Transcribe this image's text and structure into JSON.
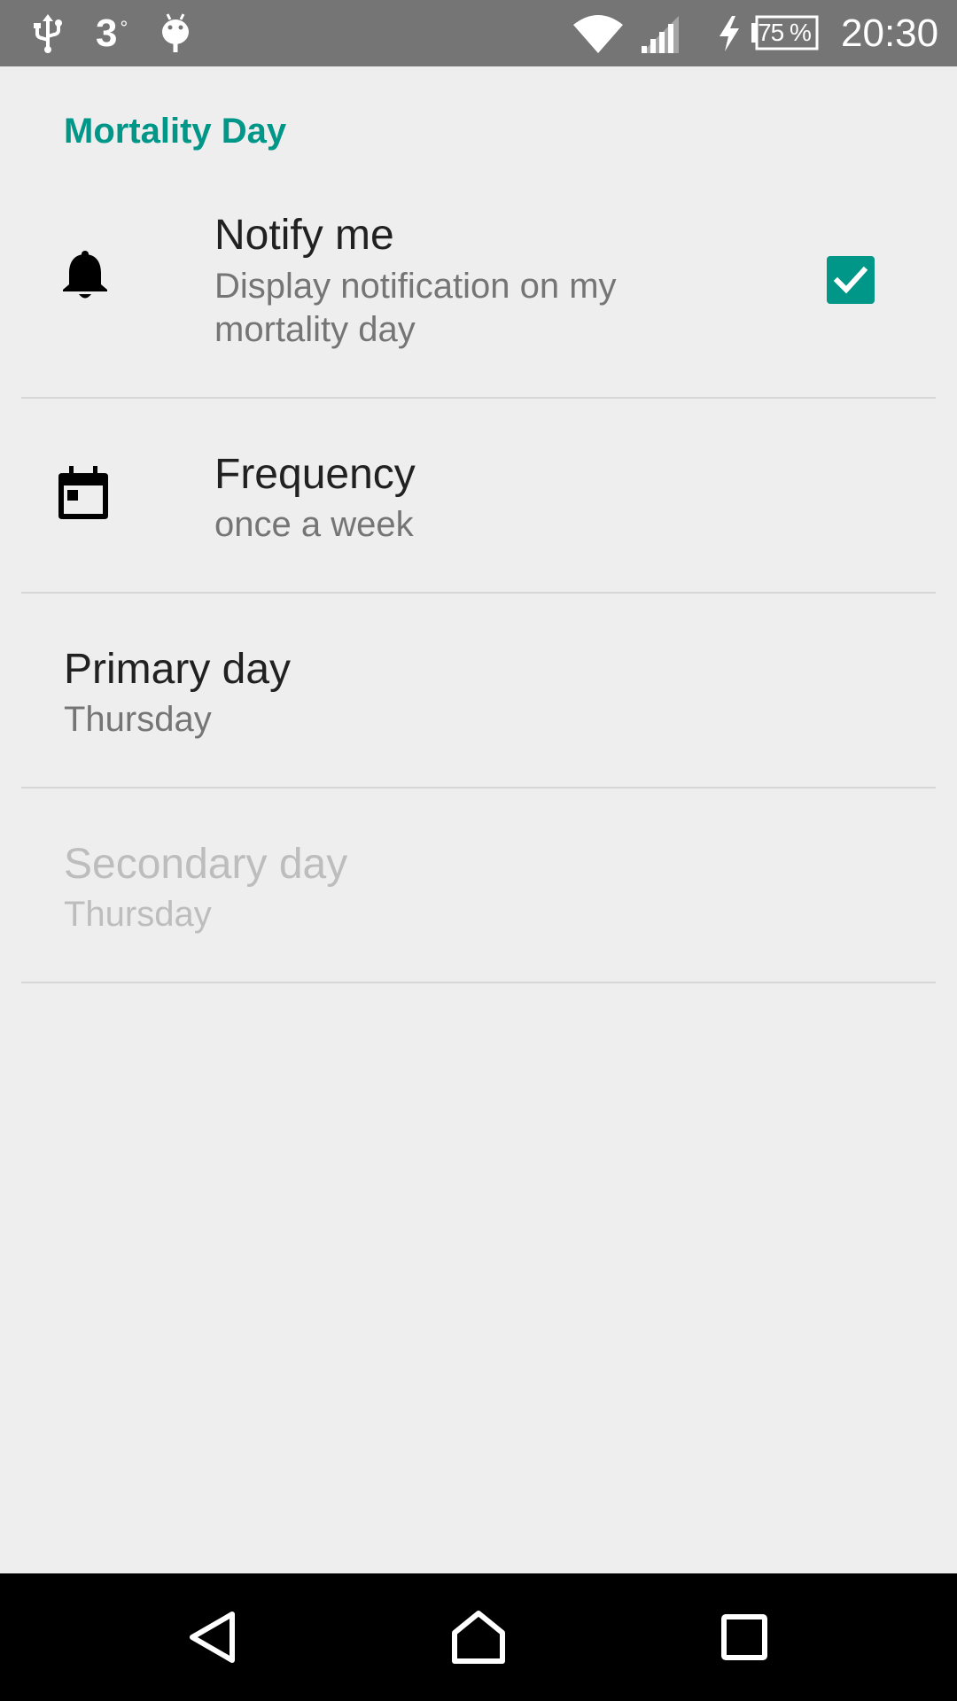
{
  "status_bar": {
    "temperature": "3",
    "temperature_unit": "°",
    "battery_percent": "75 %",
    "time": "20:30",
    "icons": [
      "usb-icon",
      "weather-icon",
      "android-debug-icon",
      "wifi-icon",
      "cell-signal-icon",
      "charging-icon",
      "battery-icon"
    ]
  },
  "category": {
    "title": "Mortality Day"
  },
  "preferences": {
    "notify": {
      "title": "Notify me",
      "summary": "Display notification on my mortality day",
      "checked": true,
      "icon": "bell-icon"
    },
    "frequency": {
      "title": "Frequency",
      "summary": "once a week",
      "icon": "calendar-icon"
    },
    "primary_day": {
      "title": "Primary day",
      "summary": "Thursday"
    },
    "secondary_day": {
      "title": "Secondary day",
      "summary": "Thursday",
      "enabled": false
    }
  },
  "nav_bar": {
    "icons": [
      "back-icon",
      "home-icon",
      "recents-icon"
    ]
  },
  "colors": {
    "accent": "#009688",
    "status_bar": "#757575",
    "background": "#eeeeee",
    "nav_bar": "#000000"
  }
}
